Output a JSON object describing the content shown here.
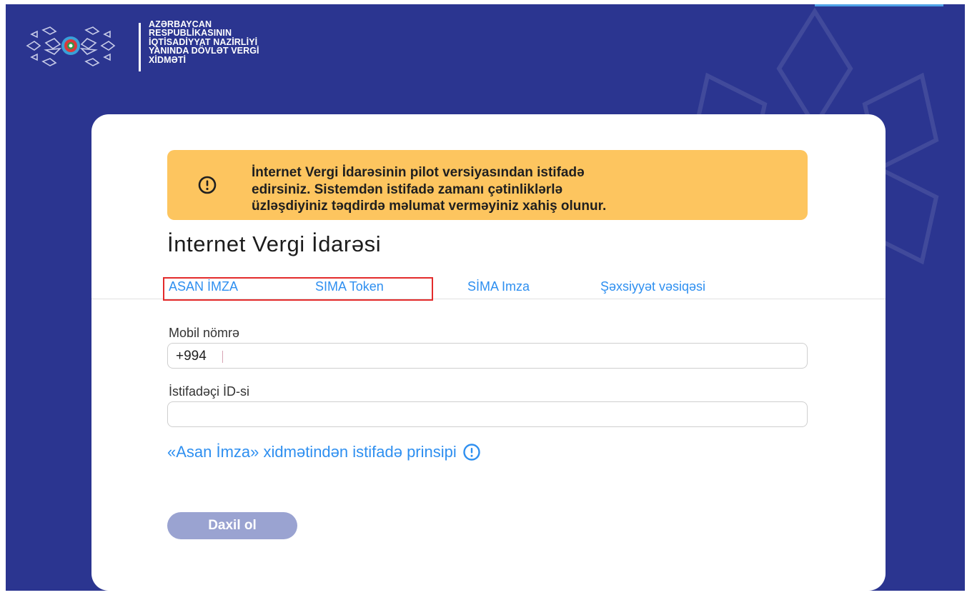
{
  "header": {
    "org_lines": [
      "AZƏRBAYCAN",
      "RESPUBLİKASININ",
      "İQTİSADİYYAT NAZİRLİYİ",
      "YANINDA DÖVLƏT VERGİ",
      "XİDMƏTİ"
    ]
  },
  "alert": {
    "icon": "exclamation-circle-icon",
    "lines": [
      "İnternet Vergi İdarəsinin pilot versiyasından istifadə",
      "edirsiniz. Sistemdən istifadə zamanı çətinliklərlə",
      "üzləşdiyiniz təqdirdə məlumat verməyiniz xahiş olunur."
    ]
  },
  "page_title": "İnternet Vergi İdarəsi",
  "tabs": [
    {
      "label": "ASAN İMZA"
    },
    {
      "label": "SIMA Token"
    },
    {
      "label": "SİMA Imza"
    },
    {
      "label": "Şəxsiyyət vəsiqəsi"
    }
  ],
  "form": {
    "mobile_label": "Mobil nömrə",
    "mobile_value": "+994",
    "user_id_label": "İstifadəçi İD-si",
    "user_id_value": ""
  },
  "principle_link": {
    "text": "«Asan İmza» xidmətindən istifadə prinsipi",
    "icon": "info-circle-icon"
  },
  "login_button": "Daxil ol",
  "colors": {
    "background": "#2b3590",
    "alert": "#fdc55f",
    "link": "#2e8ff0",
    "button_disabled": "#9aa3d1",
    "highlight": "#e32b2b"
  }
}
